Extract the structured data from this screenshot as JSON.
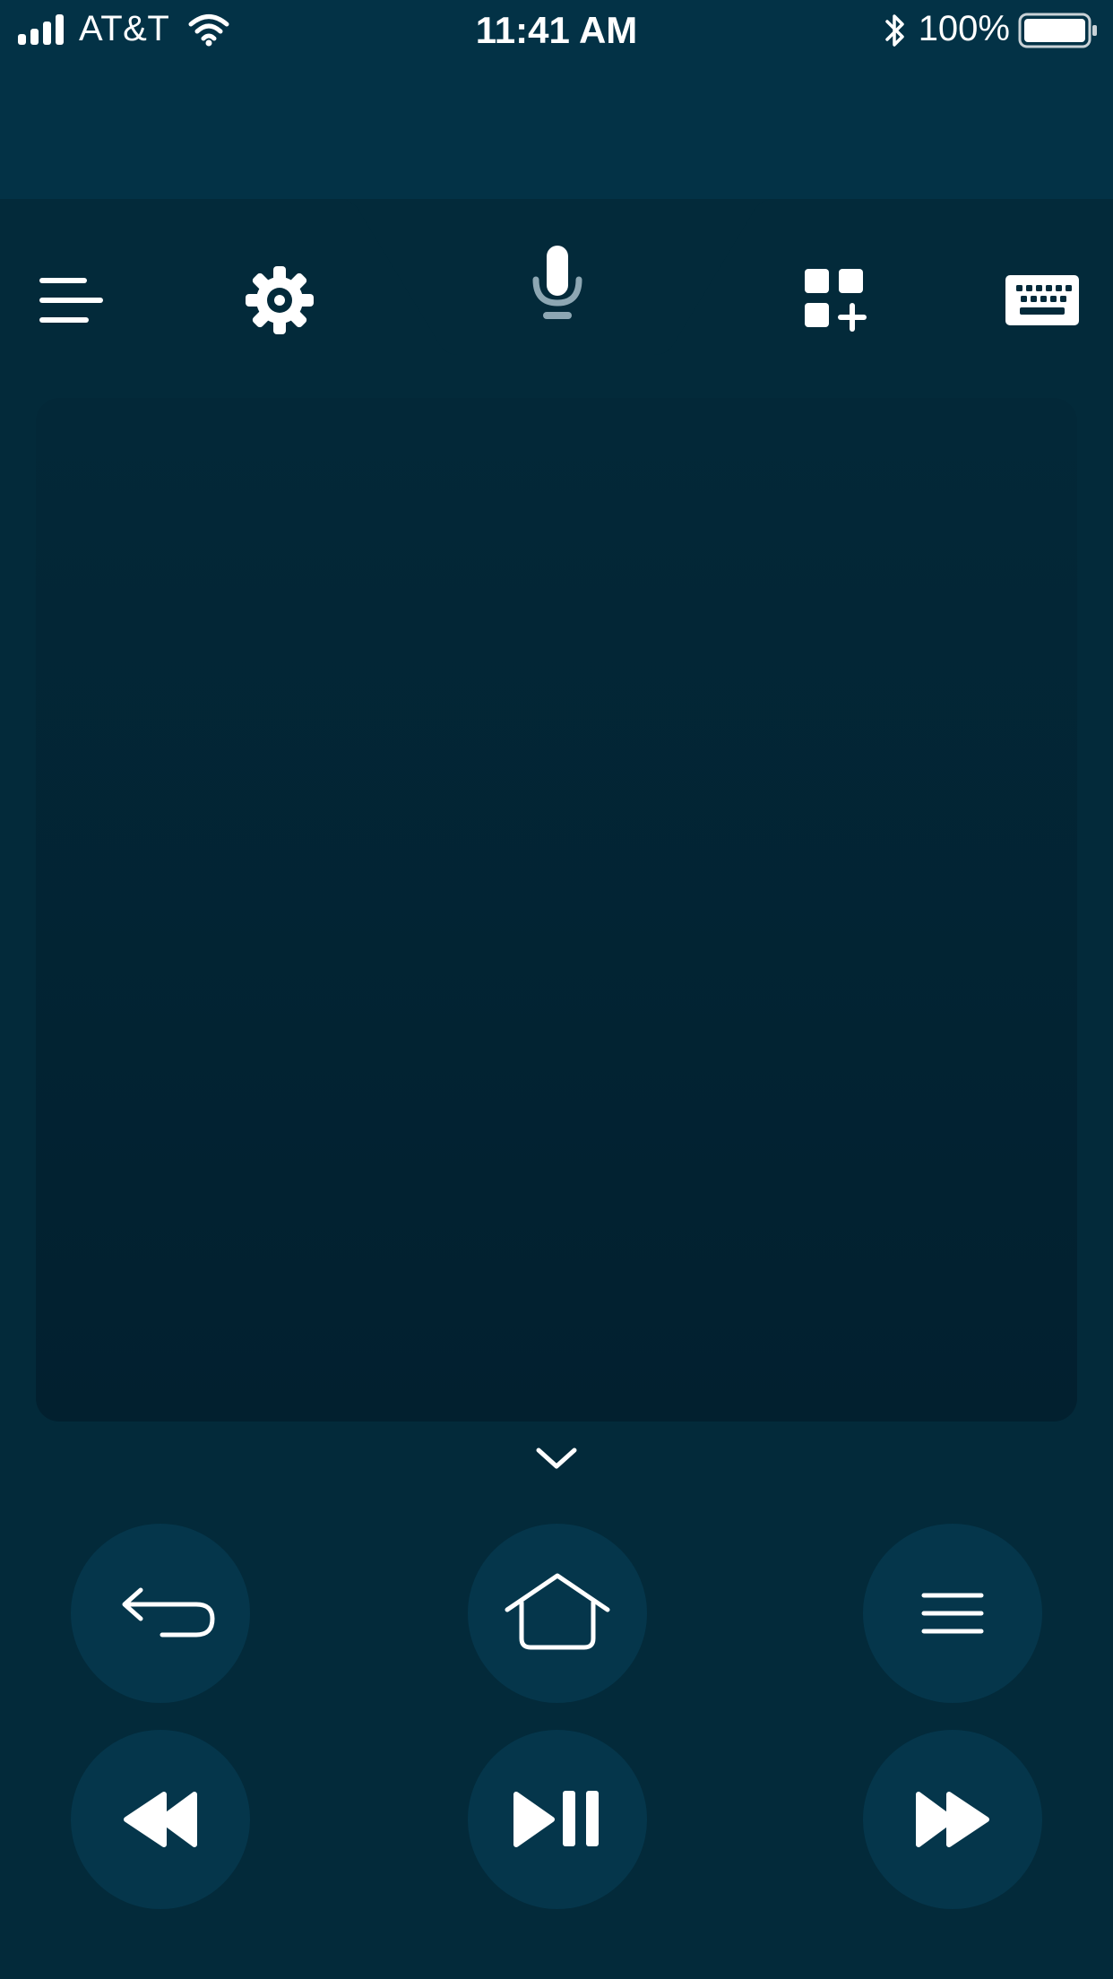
{
  "status_bar": {
    "carrier": "AT&T",
    "time": "11:41 AM",
    "battery_percent": "100%",
    "icons": [
      "signal-bars-icon",
      "wifi-icon",
      "bluetooth-icon",
      "battery-icon"
    ]
  },
  "toolbar": {
    "items": [
      {
        "name": "menu",
        "icon": "hamburger-left-icon"
      },
      {
        "name": "settings",
        "icon": "gear-icon"
      },
      {
        "name": "voice",
        "icon": "microphone-icon"
      },
      {
        "name": "apps",
        "icon": "add-app-grid-icon"
      },
      {
        "name": "keyboard",
        "icon": "keyboard-icon"
      }
    ]
  },
  "trackpad": {
    "collapse_icon": "chevron-down-icon"
  },
  "controls": {
    "row1": [
      "back-arrow-icon",
      "home-icon",
      "menu-lines-icon"
    ],
    "row2": [
      "rewind-icon",
      "play-pause-icon",
      "fast-forward-icon"
    ]
  },
  "colors": {
    "background": "#032a3a",
    "top_band": "#033246",
    "trackpad": "#02202f",
    "button": "#05364b",
    "icon": "#ffffff"
  }
}
